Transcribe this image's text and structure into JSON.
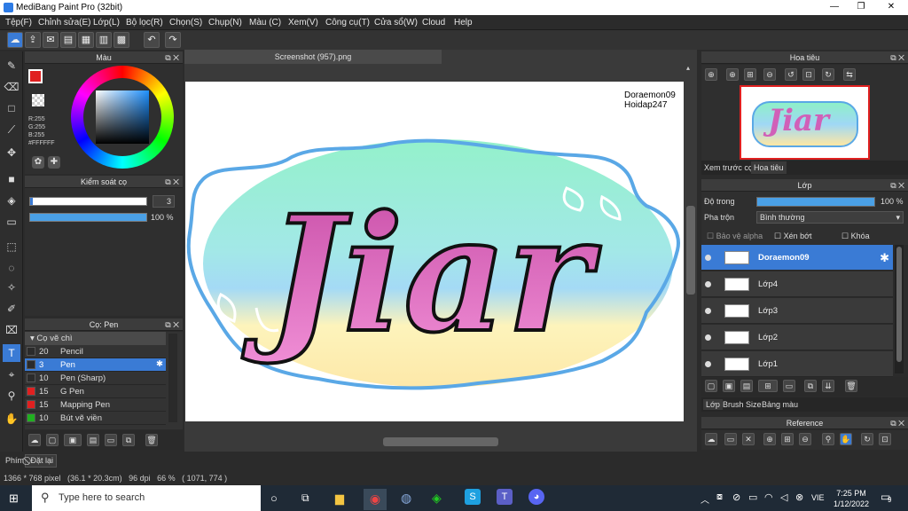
{
  "window": {
    "title": "MediBang Paint Pro (32bit)"
  },
  "menu": [
    "Tệp(F)",
    "Chỉnh sửa(E)",
    "Lớp(L)",
    "Bộ lọc(R)",
    "Chọn(S)",
    "Chụp(N)",
    "Màu (C)",
    "Xem(V)",
    "Công cụ(T)",
    "Cửa sổ(W)",
    "Cloud",
    "Help"
  ],
  "color_panel": {
    "title": "Màu",
    "r": "R:255",
    "g": "G:255",
    "b": "B:255",
    "hex": "#FFFFFF"
  },
  "brush_control": {
    "title": "Kiểm soát cọ",
    "size": "3",
    "opacity": "100 %",
    "opacity_value": 1.0
  },
  "brush_panel": {
    "title": "Cọ: Pen",
    "group": "Cọ vẽ chì",
    "rows": [
      {
        "size": "20",
        "name": "Pencil",
        "color": "#2b2b2b"
      },
      {
        "size": "3",
        "name": "Pen",
        "color": "#2b2b2b"
      },
      {
        "size": "10",
        "name": "Pen (Sharp)",
        "color": "#2b2b2b"
      },
      {
        "size": "15",
        "name": "G Pen",
        "color": "#e02020"
      },
      {
        "size": "15",
        "name": "Mapping Pen",
        "color": "#e02020"
      },
      {
        "size": "10",
        "name": "Bút vẽ viền",
        "color": "#20b020"
      }
    ]
  },
  "doc": {
    "tab": "Screenshot (957).png",
    "watermark1": "Doraemon09",
    "watermark2": "Hoidap247",
    "art_text": "Jiar"
  },
  "navigator": {
    "title": "Hoa tiêu",
    "tab1": "Xem trước cọ",
    "tab2": "Hoa tiêu"
  },
  "layer_panel": {
    "title": "Lớp",
    "opacity_label": "Độ trong",
    "opacity": "100 %",
    "blend_label": "Pha trộn",
    "blend": "Bình thường",
    "chk_alpha": "Bảo vệ alpha",
    "chk_clip": "Xén bớt",
    "chk_lock": "Khóa",
    "layers": [
      "Doraemon09",
      "Lớp4",
      "Lớp3",
      "Lớp2",
      "Lớp1"
    ],
    "tabs": [
      "Lớp",
      "Brush Size",
      "Bảng màu"
    ]
  },
  "reference": {
    "title": "Reference"
  },
  "bottom_left": {
    "tab": "Phím",
    "reset": "Đặt lại"
  },
  "status": {
    "text": "1366 * 768 pixel   (36.1 * 20.3cm)   96 dpi   66 %   ( 1071, 774 )"
  },
  "taskbar": {
    "search": "Type here to search",
    "lang": "VIE",
    "time": "7:25 PM",
    "date": "1/12/2022",
    "badge": "9"
  },
  "colors": {
    "accent": "#3a7bd5",
    "primary": "#e02020"
  }
}
